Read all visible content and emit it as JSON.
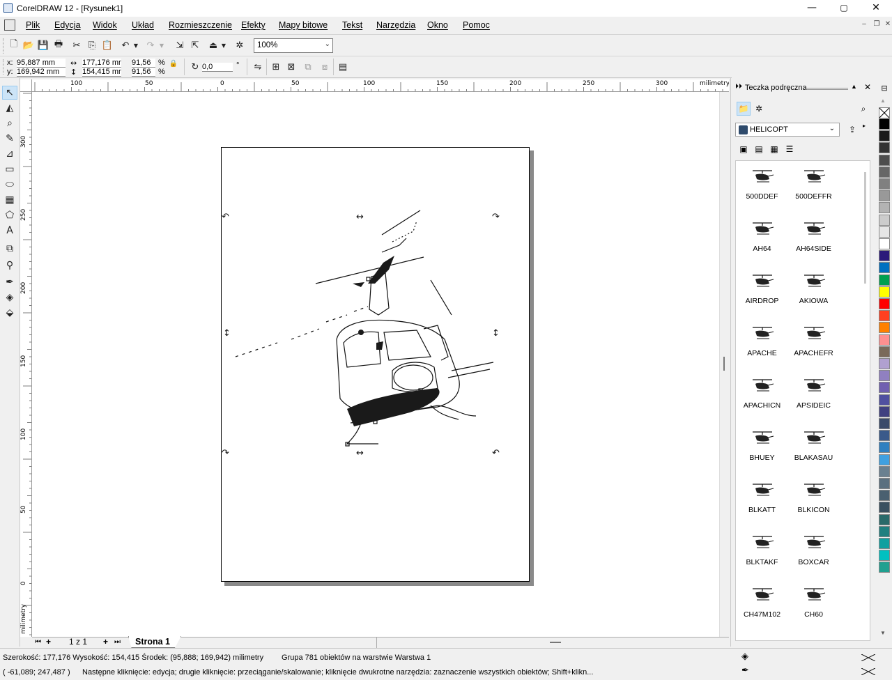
{
  "app": {
    "title": "CorelDRAW 12 - [Rysunek1]",
    "minimize": "—",
    "maximize": "▢",
    "close": "✕"
  },
  "menu": [
    {
      "label": "Plik"
    },
    {
      "label": "Edycja"
    },
    {
      "label": "Widok"
    },
    {
      "label": "Układ"
    },
    {
      "label": "Rozmieszczenie"
    },
    {
      "label": "Efekty"
    },
    {
      "label": "Mapy bitowe"
    },
    {
      "label": "Tekst"
    },
    {
      "label": "Narzędzia"
    },
    {
      "label": "Okno"
    },
    {
      "label": "Pomoc"
    }
  ],
  "toolbar": {
    "zoom": "100%"
  },
  "property_bar": {
    "x_label": "x:",
    "y_label": "y:",
    "x_value": "95,887 mm",
    "y_value": "169,942 mm",
    "width_value": "177,176 mm",
    "height_value": "154,415 mm",
    "scale_x": "91,56",
    "scale_y": "91,56",
    "percent": "%",
    "rotation": "0,0",
    "degree": "°"
  },
  "rulers": {
    "unit": "milimetry",
    "h_labels": [
      "100",
      "50",
      "0",
      "50",
      "100",
      "150",
      "200",
      "250",
      "300"
    ],
    "v_labels": [
      "300",
      "250",
      "200",
      "150",
      "100",
      "50",
      "0"
    ]
  },
  "page_tabs": {
    "page_count": "1 z 1",
    "active_tab": "Strona 1"
  },
  "docker": {
    "title": "Teczka podręczna",
    "folder": "HELICOPT",
    "items": [
      {
        "label": "500DDEF"
      },
      {
        "label": "500DEFFR"
      },
      {
        "label": "AH64"
      },
      {
        "label": "AH64SIDE"
      },
      {
        "label": "AIRDROP"
      },
      {
        "label": "AKIOWA"
      },
      {
        "label": "APACHE"
      },
      {
        "label": "APACHEFR"
      },
      {
        "label": "APACHICN"
      },
      {
        "label": "APSIDEIC"
      },
      {
        "label": "BHUEY"
      },
      {
        "label": "BLAKASAU"
      },
      {
        "label": "BLKATT"
      },
      {
        "label": "BLKICON"
      },
      {
        "label": "BLKTAKF"
      },
      {
        "label": "BOXCAR"
      },
      {
        "label": "CH47M102"
      },
      {
        "label": "CH60"
      }
    ]
  },
  "palette": [
    "#000000",
    "#1a1a1a",
    "#333333",
    "#4d4d4d",
    "#666666",
    "#808080",
    "#999999",
    "#b3b3b3",
    "#cccccc",
    "#e6e6e6",
    "#ffffff",
    "#2b1a7a",
    "#0070c0",
    "#00a050",
    "#ffff00",
    "#ff0000",
    "#ff4020",
    "#ff8000",
    "#ff9090",
    "#7a6a5a",
    "#b0a0d0",
    "#9080c0",
    "#7060b0",
    "#5050a0",
    "#404080",
    "#3a4a6a",
    "#3a5a8a",
    "#3080c0",
    "#40a0e0",
    "#6a8090",
    "#5a7080",
    "#4a6070",
    "#3a5060",
    "#2a6a6a",
    "#208080",
    "#10a0a0",
    "#00c0c0",
    "#20a090"
  ],
  "status": {
    "line1": "Szerokość: 177,176  Wysokość: 154,415  Środek: (95,888; 169,942)  milimetry",
    "line1b": "Grupa 781 obiektów na warstwie Warstwa 1",
    "cursor": "( -61,089; 247,487 )",
    "hint": "Następne kliknięcie: edycja; drugie kliknięcie: przeciąganie/skalowanie; kliknięcie dwukrotne narzędzia: zaznaczenie wszystkich obiektów; Shift+klikn..."
  }
}
